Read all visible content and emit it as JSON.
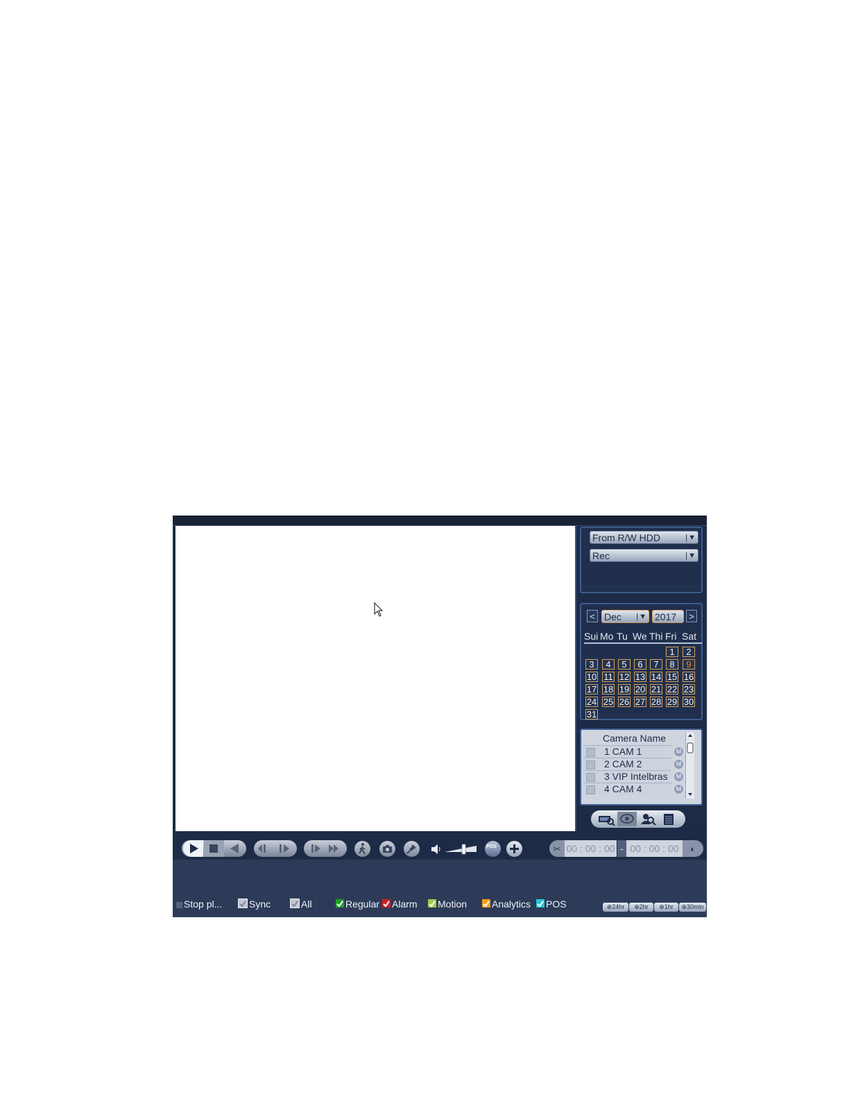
{
  "source": {
    "label": "From R/W HDD"
  },
  "rec_type": {
    "label": "Rec"
  },
  "calendar": {
    "prev": "<",
    "next": ">",
    "month": "Dec",
    "year": "2017",
    "weekdays": [
      "Sui",
      "Mo",
      "Tu",
      "We",
      "Thi",
      "Fri",
      "Sat"
    ],
    "days": [
      "1",
      "2",
      "3",
      "4",
      "5",
      "6",
      "7",
      "8",
      "9",
      "10",
      "11",
      "12",
      "13",
      "14",
      "15",
      "16",
      "17",
      "18",
      "19",
      "20",
      "21",
      "22",
      "23",
      "24",
      "25",
      "26",
      "27",
      "28",
      "29",
      "30",
      "31"
    ],
    "highlighted_day": "9"
  },
  "cameras": {
    "header": "Camera Name",
    "rows": [
      "1 CAM 1",
      "2 CAM 2",
      "3 VIP Intelbras",
      "4 CAM 4"
    ],
    "row_button": "M"
  },
  "tabs": [
    "search-file-icon",
    "smart-search-icon",
    "face-search-icon",
    "list-icon"
  ],
  "controls": {
    "time_start": "00 : 00 : 00",
    "time_sep": "-",
    "time_end": "00 : 00 : 00",
    "pos_label": "POS",
    "volume_level": 0.6
  },
  "bottom": {
    "stop": "Stop pl...",
    "sync": "Sync",
    "all": "All",
    "regular": "Regular",
    "alarm": "Alarm",
    "motion": "Motion",
    "analytics": "Analytics",
    "pos": "POS",
    "colors": {
      "regular": "#1fa12a",
      "alarm": "#d21f1f",
      "motion": "#a3c94a",
      "analytics": "#f0a020",
      "pos": "#27c6d8"
    },
    "zoom": [
      "24hr",
      "2hr",
      "1hr",
      "30min"
    ]
  }
}
